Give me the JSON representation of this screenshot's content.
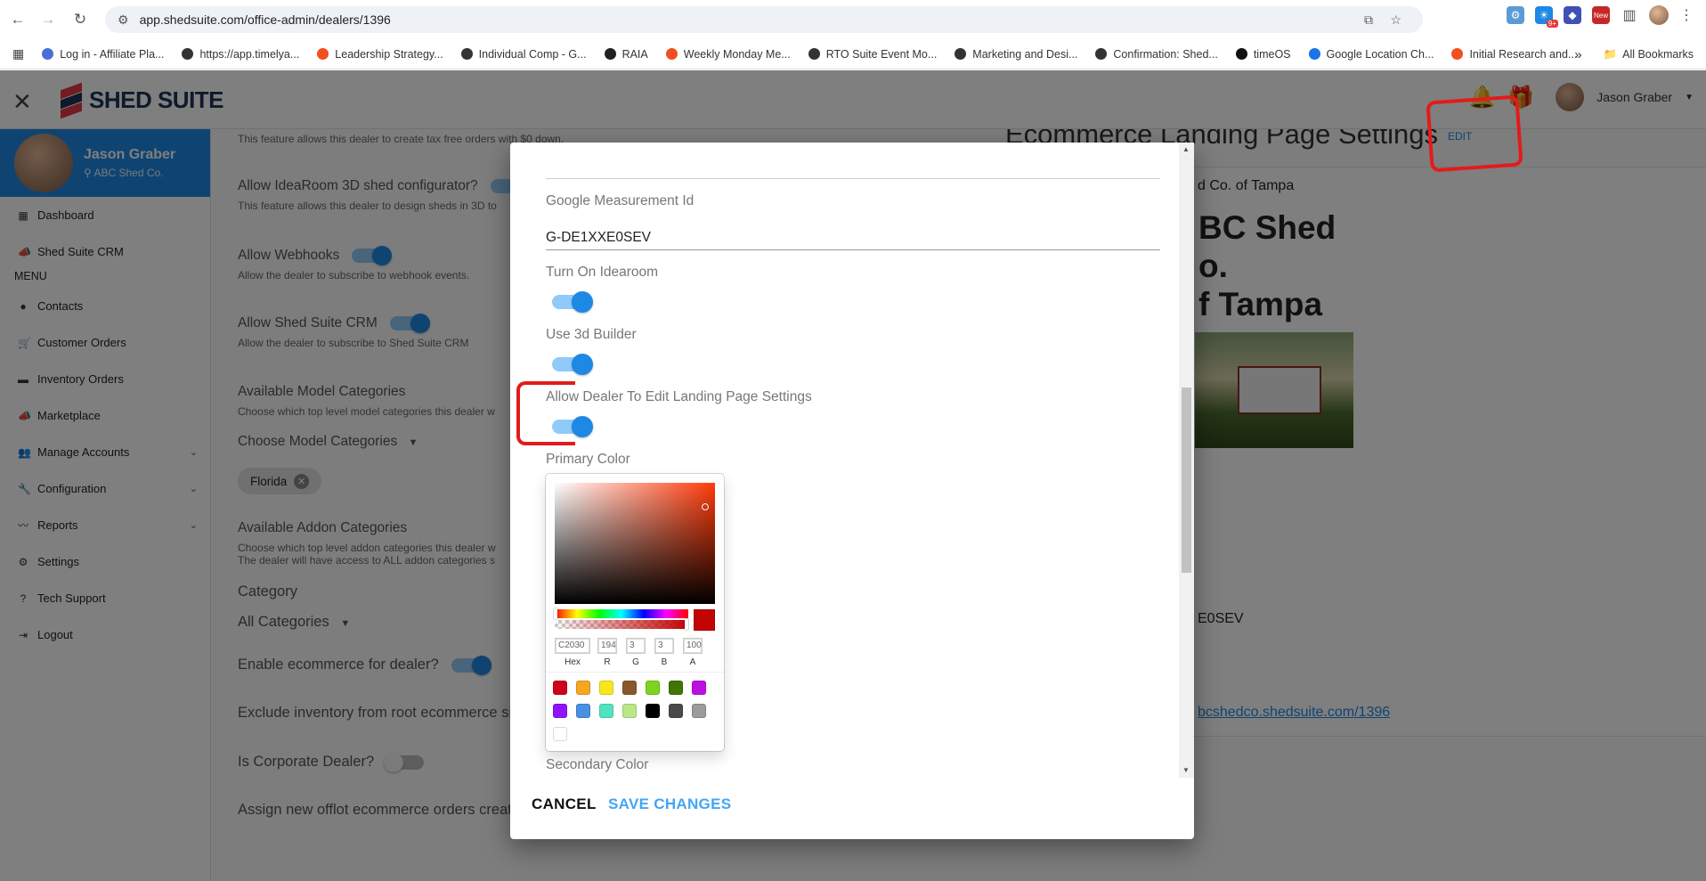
{
  "browser": {
    "url": "app.shedsuite.com/office-admin/dealers/1396",
    "bookmarks": [
      {
        "label": "Log in - Affiliate Pla...",
        "color": "#4a6fd6"
      },
      {
        "label": "https://app.timelya...",
        "color": "#333333"
      },
      {
        "label": "Leadership Strategy...",
        "color": "#f24e1e"
      },
      {
        "label": "Individual Comp - G...",
        "color": "#333333"
      },
      {
        "label": "RAIA",
        "color": "#222222"
      },
      {
        "label": "Weekly Monday Me...",
        "color": "#f24e1e"
      },
      {
        "label": "RTO Suite Event Mo...",
        "color": "#333333"
      },
      {
        "label": "Marketing and Desi...",
        "color": "#333333"
      },
      {
        "label": "Confirmation: Shed...",
        "color": "#333333"
      },
      {
        "label": "timeOS",
        "color": "#111111"
      },
      {
        "label": "Google Location Ch...",
        "color": "#1a73e8"
      },
      {
        "label": "Initial Research and...",
        "color": "#f24e1e"
      }
    ],
    "all_bookmarks": "All Bookmarks",
    "more_icon": "»",
    "ext_badges": [
      "9+",
      "New"
    ]
  },
  "header": {
    "logo_text": "SHED SUITE",
    "user_name": "Jason Graber"
  },
  "sidebar": {
    "user_name": "Jason Graber",
    "user_location": "ABC Shed Co.",
    "top_items": [
      {
        "label": "Dashboard",
        "icon": "grid-icon"
      },
      {
        "label": "Shed Suite CRM",
        "icon": "megaphone-icon"
      }
    ],
    "menu_heading": "MENU",
    "items": [
      {
        "label": "Contacts",
        "icon": "person-circle-icon"
      },
      {
        "label": "Customer Orders",
        "icon": "cart-icon"
      },
      {
        "label": "Inventory Orders",
        "icon": "warehouse-icon"
      },
      {
        "label": "Marketplace",
        "icon": "megaphone-icon"
      },
      {
        "label": "Manage Accounts",
        "icon": "people-icon",
        "expandable": true
      },
      {
        "label": "Configuration",
        "icon": "wrench-icon",
        "expandable": true
      },
      {
        "label": "Reports",
        "icon": "trending-icon",
        "expandable": true
      },
      {
        "label": "Settings",
        "icon": "gear-icon"
      },
      {
        "label": "Tech Support",
        "icon": "help-icon"
      },
      {
        "label": "Logout",
        "icon": "logout-icon"
      }
    ]
  },
  "main": {
    "tax_free_sub": "This feature allows this dealer to create tax free orders with $0 down.",
    "ideaRoom_label": "Allow IdeaRoom 3D shed configurator?",
    "ideaRoom_sub": "This feature allows this dealer to design sheds in 3D to",
    "webhooks_label": "Allow Webhooks",
    "webhooks_sub": "Allow the dealer to subscribe to webhook events.",
    "crm_label": "Allow Shed Suite CRM",
    "crm_sub": "Allow the dealer to subscribe to Shed Suite CRM",
    "model_cat_label": "Available Model Categories",
    "model_cat_sub": "Choose which top level model categories this dealer w",
    "choose_model": "Choose Model Categories",
    "chip": "Florida",
    "addon_cat_label": "Available Addon Categories",
    "addon_cat_sub1": "Choose which top level addon categories this dealer w",
    "addon_cat_sub2": "The dealer will have access to ALL addon categories s",
    "category_label": "Category",
    "category_value": "All Categories",
    "ecommerce_label": "Enable ecommerce for dealer?",
    "exclude_label": "Exclude inventory from root ecommerce sit",
    "corporate_label": "Is Corporate Dealer?",
    "assign_label": "Assign new offlot ecommerce orders create"
  },
  "right_panel": {
    "title": "Ecommerce Landing Page Settings",
    "edit": "EDIT",
    "store_name": "d Co. of Tampa",
    "hero_line1": "BC Shed",
    "hero_line2": "o.",
    "hero_line3": "f Tampa",
    "measurement": "E0SEV",
    "link": "bcshedco.shedsuite.com/1396"
  },
  "modal": {
    "measurement_label": "Google Measurement Id",
    "measurement_value": "G-DE1XXE0SEV",
    "idearoom_label": "Turn On Idearoom",
    "builder_label": "Use 3d Builder",
    "allow_edit_label": "Allow Dealer To Edit Landing Page Settings",
    "primary_color_label": "Primary Color",
    "secondary_color_label": "Secondary Color",
    "picker": {
      "hex": "C2030",
      "r": "194",
      "g": "3",
      "b": "3",
      "a": "100",
      "hex_label": "Hex",
      "r_label": "R",
      "g_label": "G",
      "b_label": "B",
      "a_label": "A",
      "selected_color": "#c20303",
      "alpha_level": 1.0,
      "swatches": [
        "#D0021B",
        "#F5A623",
        "#F8E71C",
        "#8B572A",
        "#7ED321",
        "#417505",
        "#BD10E0",
        "#9013FE",
        "#4A90E2",
        "#50E3C2",
        "#B8E986",
        "#000000",
        "#4A4A4A",
        "#9B9B9B",
        "#FFFFFF"
      ]
    },
    "cancel": "CANCEL",
    "save": "SAVE CHANGES"
  },
  "colors": {
    "accent": "#1e88e5",
    "annotation": "#e31b1b"
  }
}
